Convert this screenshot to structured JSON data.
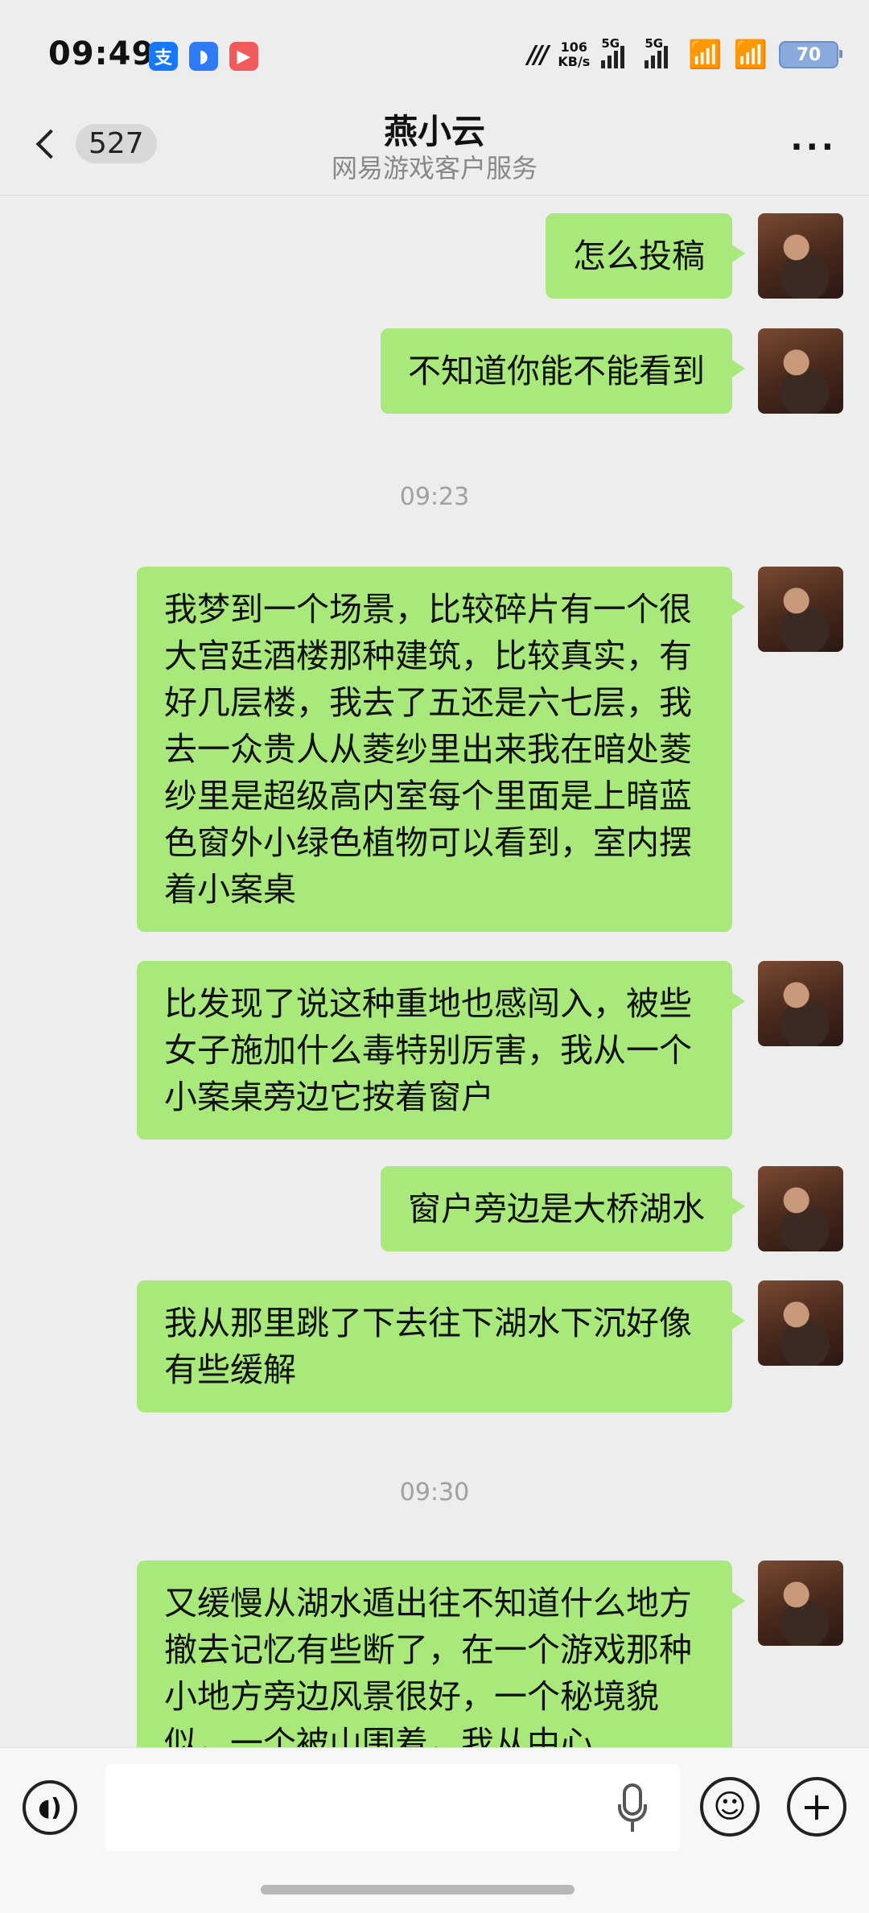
{
  "status_bar": {
    "time": "09:49",
    "app_icons": [
      "alipay-icon",
      "browser-icon",
      "video-app-icon"
    ],
    "net_speed_value": "106",
    "net_speed_unit": "KB/s",
    "sim1_label": "5G",
    "sim2_label": "5G",
    "battery": "70"
  },
  "header": {
    "back_count": "527",
    "title": "燕小云",
    "subtitle": "网易游戏客户服务",
    "more": "···"
  },
  "messages": [
    {
      "type": "msg",
      "text": "怎么投稿"
    },
    {
      "type": "msg",
      "text": "不知道你能不能看到"
    },
    {
      "type": "time",
      "text": "09:23"
    },
    {
      "type": "msg",
      "text": "我梦到一个场景，比较碎片有一个很大宫廷酒楼那种建筑，比较真实，有好几层楼，我去了五还是六七层，我去一众贵人从菱纱里出来我在暗处菱纱里是超级高内室每个里面是上暗蓝色窗外小绿色植物可以看到，室内摆着小案桌"
    },
    {
      "type": "msg",
      "text": "比发现了说这种重地也感闯入，被些女子施加什么毒特别厉害，我从一个小案桌旁边它按着窗户"
    },
    {
      "type": "msg",
      "text": "窗户旁边是大桥湖水"
    },
    {
      "type": "msg",
      "text": "我从那里跳了下去往下湖水下沉好像有些缓解"
    },
    {
      "type": "time",
      "text": "09:30"
    },
    {
      "type": "msg",
      "text": "又缓慢从湖水遁出往不知道什么地方撤去记忆有些断了，在一个游戏那种小地方旁边风景很好，一个秘境貌似，一个被山围着，我从中心"
    }
  ],
  "input_bar": {
    "voice_icon": "voice-icon",
    "mic_icon": "mic-icon",
    "emoji_icon": "emoji-icon",
    "add_icon": "add-icon",
    "text_value": ""
  }
}
